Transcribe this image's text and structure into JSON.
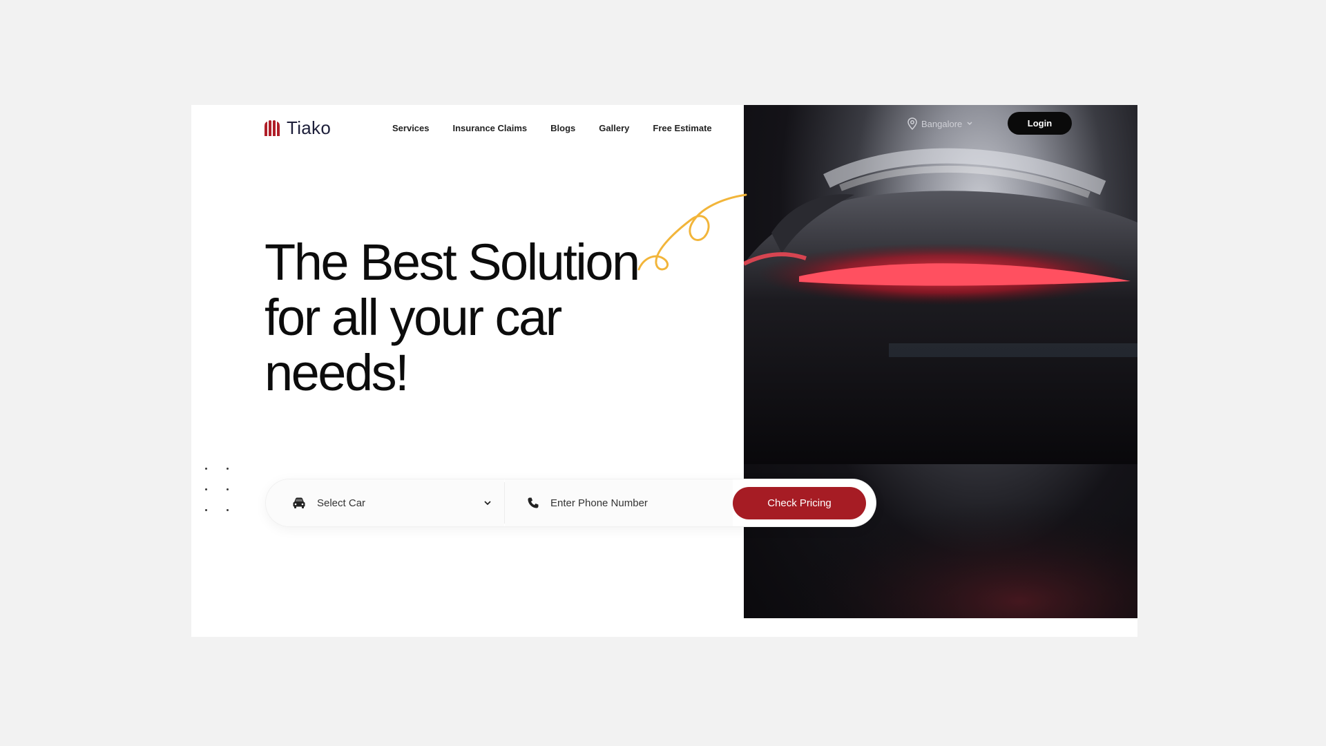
{
  "brand": {
    "name": "Tiako",
    "accent_color": "#a61c24",
    "logo_icon": "tiako-logo-icon"
  },
  "nav": {
    "items": [
      {
        "label": "Services"
      },
      {
        "label": "Insurance Claims"
      },
      {
        "label": "Blogs"
      },
      {
        "label": "Gallery"
      },
      {
        "label": "Free Estimate"
      }
    ]
  },
  "header": {
    "location": "Bangalore",
    "location_icon": "map-pin-icon",
    "login_label": "Login"
  },
  "hero": {
    "headline": "The Best Solution for all your car needs!"
  },
  "search": {
    "select_car_label": "Select Car",
    "car_icon": "car-icon",
    "phone_placeholder": "Enter Phone Number",
    "phone_icon": "phone-icon",
    "submit_label": "Check Pricing"
  }
}
